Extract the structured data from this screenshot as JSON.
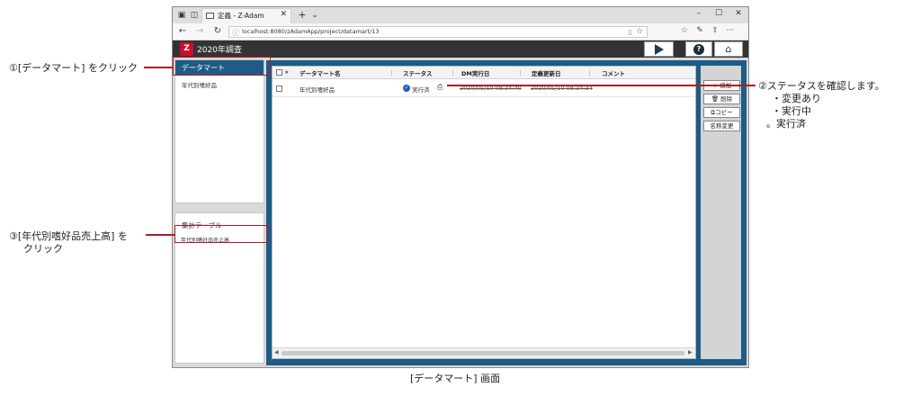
{
  "browser": {
    "tab_title": "定義 - Z-Adam",
    "url": "localhost:8080/zAdamApp/project/datamart/13"
  },
  "app": {
    "title": "2020年調査"
  },
  "left_panel": {
    "tab_label": "データマート",
    "items": [
      "年代別嗜好品"
    ]
  },
  "aggregate_panel": {
    "title": "集計テーブル",
    "items": [
      "年代別嗜好品売上高"
    ]
  },
  "grid": {
    "star_mark": "★",
    "columns": [
      "データマート名",
      "ステータス",
      "DM実行日",
      "定義更新日",
      "コメント"
    ],
    "rows": [
      {
        "name": "年代別嗜好品",
        "status": "実行済",
        "dm_run_date": "2020/05/10 08:34:40",
        "def_update_date": "2020/05/10 08:34:34",
        "comment": ""
      }
    ]
  },
  "side_buttons": {
    "add": "＋ 追加",
    "delete": "🗑 削除",
    "copy": "コピー",
    "rename": "名称変更"
  },
  "callouts": {
    "c1": "①[データマート] をクリック",
    "c2": "②ステータスを確認します。",
    "c2_items": [
      "・変更あり",
      "・実行中",
      "。実行済"
    ],
    "c3_line1": "③[年代別嗜好品売上高] を",
    "c3_line2": "クリック"
  },
  "caption": "[データマート] 画面",
  "colors": {
    "accent": "#1e5b87",
    "header": "#333333",
    "annotation": "#b01c22"
  }
}
